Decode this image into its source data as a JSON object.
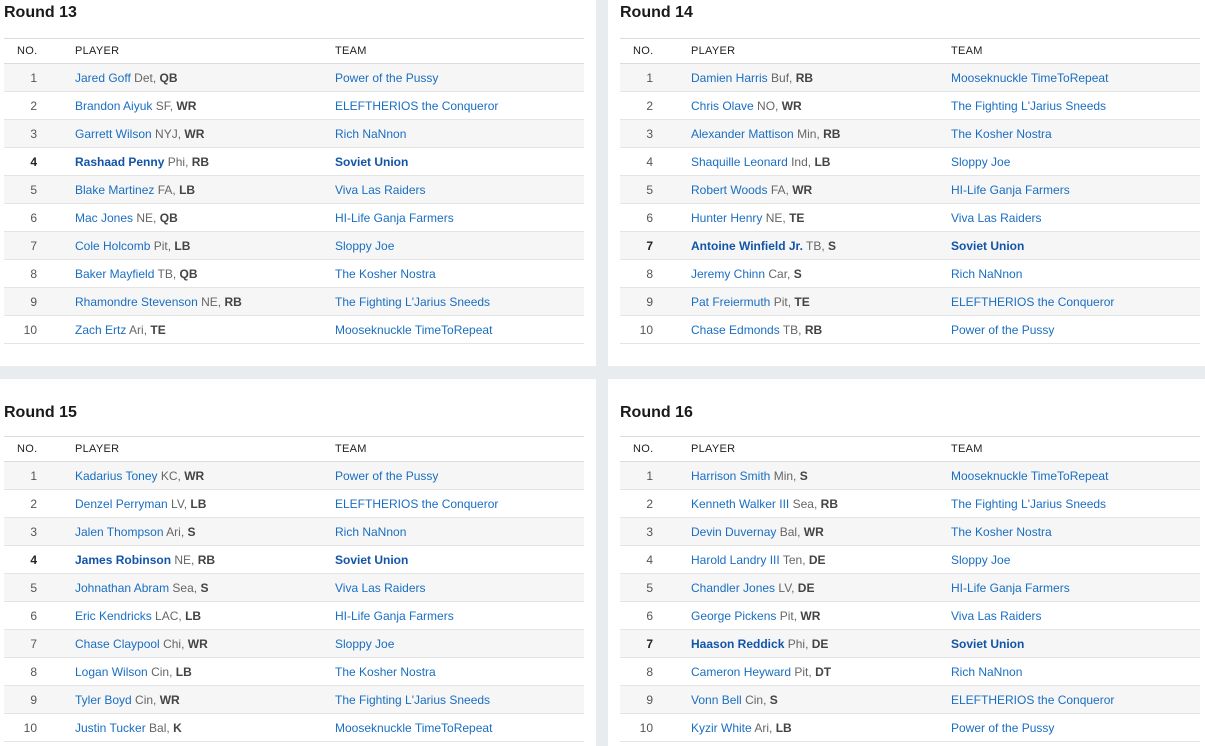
{
  "headers": {
    "no": "NO.",
    "player": "PLAYER",
    "team": "TEAM"
  },
  "rounds": [
    {
      "title": "Round 13",
      "picks": [
        {
          "no": "1",
          "player": "Jared Goff",
          "meta": "Det,",
          "pos": "QB",
          "team": "Power of the Pussy",
          "mine": false
        },
        {
          "no": "2",
          "player": "Brandon Aiyuk",
          "meta": "SF,",
          "pos": "WR",
          "team": "ELEFTHERIOS the Conqueror",
          "mine": false
        },
        {
          "no": "3",
          "player": "Garrett Wilson",
          "meta": "NYJ,",
          "pos": "WR",
          "team": "Rich NaNnon",
          "mine": false
        },
        {
          "no": "4",
          "player": "Rashaad Penny",
          "meta": "Phi,",
          "pos": "RB",
          "team": "Soviet Union",
          "mine": true
        },
        {
          "no": "5",
          "player": "Blake Martinez",
          "meta": "FA,",
          "pos": "LB",
          "team": "Viva Las Raiders",
          "mine": false
        },
        {
          "no": "6",
          "player": "Mac Jones",
          "meta": "NE,",
          "pos": "QB",
          "team": "HI-Life Ganja Farmers",
          "mine": false
        },
        {
          "no": "7",
          "player": "Cole Holcomb",
          "meta": "Pit,",
          "pos": "LB",
          "team": "Sloppy Joe",
          "mine": false
        },
        {
          "no": "8",
          "player": "Baker Mayfield",
          "meta": "TB,",
          "pos": "QB",
          "team": "The Kosher Nostra",
          "mine": false
        },
        {
          "no": "9",
          "player": "Rhamondre Stevenson",
          "meta": "NE,",
          "pos": "RB",
          "team": "The Fighting L'Jarius Sneeds",
          "mine": false
        },
        {
          "no": "10",
          "player": "Zach Ertz",
          "meta": "Ari,",
          "pos": "TE",
          "team": "Mooseknuckle TimeToRepeat",
          "mine": false
        }
      ]
    },
    {
      "title": "Round 14",
      "picks": [
        {
          "no": "1",
          "player": "Damien Harris",
          "meta": "Buf,",
          "pos": "RB",
          "team": "Mooseknuckle TimeToRepeat",
          "mine": false
        },
        {
          "no": "2",
          "player": "Chris Olave",
          "meta": "NO,",
          "pos": "WR",
          "team": "The Fighting L'Jarius Sneeds",
          "mine": false
        },
        {
          "no": "3",
          "player": "Alexander Mattison",
          "meta": "Min,",
          "pos": "RB",
          "team": "The Kosher Nostra",
          "mine": false
        },
        {
          "no": "4",
          "player": "Shaquille Leonard",
          "meta": "Ind,",
          "pos": "LB",
          "team": "Sloppy Joe",
          "mine": false
        },
        {
          "no": "5",
          "player": "Robert Woods",
          "meta": "FA,",
          "pos": "WR",
          "team": "HI-Life Ganja Farmers",
          "mine": false
        },
        {
          "no": "6",
          "player": "Hunter Henry",
          "meta": "NE,",
          "pos": "TE",
          "team": "Viva Las Raiders",
          "mine": false
        },
        {
          "no": "7",
          "player": "Antoine Winfield Jr.",
          "meta": "TB,",
          "pos": "S",
          "team": "Soviet Union",
          "mine": true
        },
        {
          "no": "8",
          "player": "Jeremy Chinn",
          "meta": "Car,",
          "pos": "S",
          "team": "Rich NaNnon",
          "mine": false
        },
        {
          "no": "9",
          "player": "Pat Freiermuth",
          "meta": "Pit,",
          "pos": "TE",
          "team": "ELEFTHERIOS the Conqueror",
          "mine": false
        },
        {
          "no": "10",
          "player": "Chase Edmonds",
          "meta": "TB,",
          "pos": "RB",
          "team": "Power of the Pussy",
          "mine": false
        }
      ]
    },
    {
      "title": "Round 15",
      "picks": [
        {
          "no": "1",
          "player": "Kadarius Toney",
          "meta": "KC,",
          "pos": "WR",
          "team": "Power of the Pussy",
          "mine": false
        },
        {
          "no": "2",
          "player": "Denzel Perryman",
          "meta": "LV,",
          "pos": "LB",
          "team": "ELEFTHERIOS the Conqueror",
          "mine": false
        },
        {
          "no": "3",
          "player": "Jalen Thompson",
          "meta": "Ari,",
          "pos": "S",
          "team": "Rich NaNnon",
          "mine": false
        },
        {
          "no": "4",
          "player": "James Robinson",
          "meta": "NE,",
          "pos": "RB",
          "team": "Soviet Union",
          "mine": true
        },
        {
          "no": "5",
          "player": "Johnathan Abram",
          "meta": "Sea,",
          "pos": "S",
          "team": "Viva Las Raiders",
          "mine": false
        },
        {
          "no": "6",
          "player": "Eric Kendricks",
          "meta": "LAC,",
          "pos": "LB",
          "team": "HI-Life Ganja Farmers",
          "mine": false
        },
        {
          "no": "7",
          "player": "Chase Claypool",
          "meta": "Chi,",
          "pos": "WR",
          "team": "Sloppy Joe",
          "mine": false
        },
        {
          "no": "8",
          "player": "Logan Wilson",
          "meta": "Cin,",
          "pos": "LB",
          "team": "The Kosher Nostra",
          "mine": false
        },
        {
          "no": "9",
          "player": "Tyler Boyd",
          "meta": "Cin,",
          "pos": "WR",
          "team": "The Fighting L'Jarius Sneeds",
          "mine": false
        },
        {
          "no": "10",
          "player": "Justin Tucker",
          "meta": "Bal,",
          "pos": "K",
          "team": "Mooseknuckle TimeToRepeat",
          "mine": false
        }
      ]
    },
    {
      "title": "Round 16",
      "picks": [
        {
          "no": "1",
          "player": "Harrison Smith",
          "meta": "Min,",
          "pos": "S",
          "team": "Mooseknuckle TimeToRepeat",
          "mine": false
        },
        {
          "no": "2",
          "player": "Kenneth Walker III",
          "meta": "Sea,",
          "pos": "RB",
          "team": "The Fighting L'Jarius Sneeds",
          "mine": false
        },
        {
          "no": "3",
          "player": "Devin Duvernay",
          "meta": "Bal,",
          "pos": "WR",
          "team": "The Kosher Nostra",
          "mine": false
        },
        {
          "no": "4",
          "player": "Harold Landry III",
          "meta": "Ten,",
          "pos": "DE",
          "team": "Sloppy Joe",
          "mine": false
        },
        {
          "no": "5",
          "player": "Chandler Jones",
          "meta": "LV,",
          "pos": "DE",
          "team": "HI-Life Ganja Farmers",
          "mine": false
        },
        {
          "no": "6",
          "player": "George Pickens",
          "meta": "Pit,",
          "pos": "WR",
          "team": "Viva Las Raiders",
          "mine": false
        },
        {
          "no": "7",
          "player": "Haason Reddick",
          "meta": "Phi,",
          "pos": "DE",
          "team": "Soviet Union",
          "mine": true
        },
        {
          "no": "8",
          "player": "Cameron Heyward",
          "meta": "Pit,",
          "pos": "DT",
          "team": "Rich NaNnon",
          "mine": false
        },
        {
          "no": "9",
          "player": "Vonn Bell",
          "meta": "Cin,",
          "pos": "S",
          "team": "ELEFTHERIOS the Conqueror",
          "mine": false
        },
        {
          "no": "10",
          "player": "Kyzir White",
          "meta": "Ari,",
          "pos": "LB",
          "team": "Power of the Pussy",
          "mine": false
        }
      ]
    }
  ]
}
